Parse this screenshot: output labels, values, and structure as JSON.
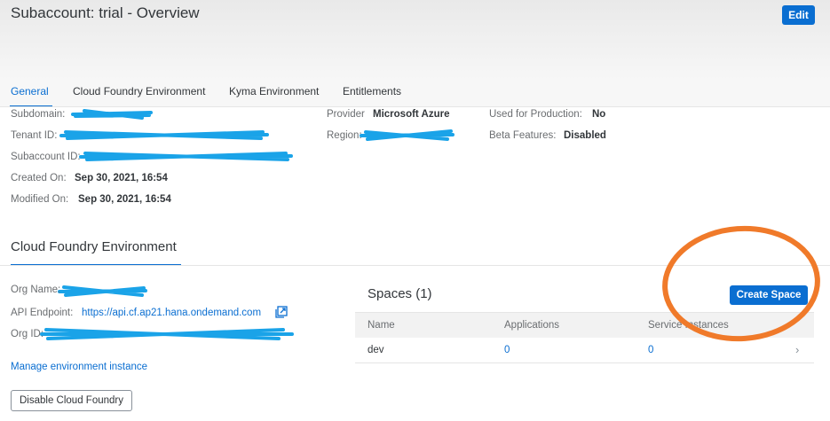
{
  "header": {
    "title": "Subaccount: trial - Overview",
    "edit_label": "Edit"
  },
  "tabs": [
    "General",
    "Cloud Foundry Environment",
    "Kyma Environment",
    "Entitlements"
  ],
  "general": {
    "subdomain_label": "Subdomain:",
    "tenant_label": "Tenant ID:",
    "subaccount_label": "Subaccount ID:",
    "created_label": "Created On:",
    "created_value": "Sep 30, 2021, 16:54",
    "modified_label": "Modified On:",
    "modified_value": "Sep 30, 2021, 16:54",
    "provider_label": "Provider",
    "provider_value": "Microsoft Azure",
    "region_label": "Region:",
    "production_label": "Used for Production:",
    "production_value": "No",
    "beta_label": "Beta Features:",
    "beta_value": "Disabled"
  },
  "cloud_foundry": {
    "title": "Cloud Foundry Environment",
    "org_name_label": "Org Name:",
    "api_label": "API Endpoint:",
    "api_value": "https://api.cf.ap21.hana.ondemand.com",
    "org_id_label": "Org ID:",
    "manage_link": "Manage environment instance",
    "disable_label": "Disable Cloud Foundry"
  },
  "spaces": {
    "title": "Spaces (1)",
    "create_label": "Create Space",
    "columns": [
      "Name",
      "Applications",
      "Service Instances"
    ],
    "rows": [
      {
        "name": "dev",
        "applications": "0",
        "service_instances": "0"
      }
    ]
  },
  "colors": {
    "accent": "#0a6ed1",
    "annotation": "#f07a2a",
    "redaction": "#1aa3e8"
  }
}
